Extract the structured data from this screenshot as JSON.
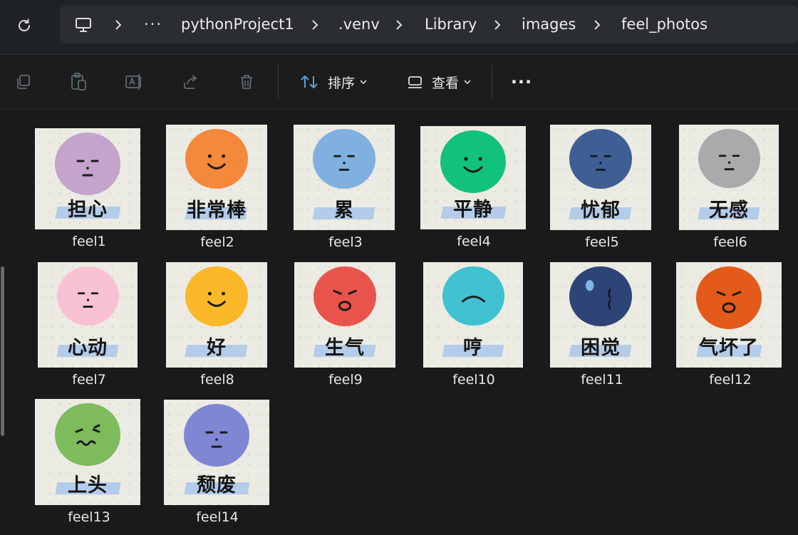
{
  "breadcrumb": {
    "overflow": "···",
    "items": [
      "pythonProject1",
      ".venv",
      "Library",
      "images",
      "feel_photos"
    ]
  },
  "toolbar": {
    "sort_label": "排序",
    "view_label": "查看",
    "more_label": "···"
  },
  "files": [
    {
      "name": "feel1",
      "caption": "担心",
      "color": "#c4a3cc",
      "expr": "worry"
    },
    {
      "name": "feel2",
      "caption": "非常棒",
      "color": "#f5883a",
      "expr": "wink"
    },
    {
      "name": "feel3",
      "caption": "累",
      "color": "#7fb0e0",
      "expr": "tired"
    },
    {
      "name": "feel4",
      "caption": "平静",
      "color": "#12c27a",
      "expr": "calm"
    },
    {
      "name": "feel5",
      "caption": "忧郁",
      "color": "#3f5f94",
      "expr": "sad"
    },
    {
      "name": "feel6",
      "caption": "无感",
      "color": "#a8aaac",
      "expr": "neutral"
    },
    {
      "name": "feel7",
      "caption": "心动",
      "color": "#f9c2d3",
      "expr": "blush"
    },
    {
      "name": "feel8",
      "caption": "好",
      "color": "#fbb829",
      "expr": "smile"
    },
    {
      "name": "feel9",
      "caption": "生气",
      "color": "#e8544c",
      "expr": "angry"
    },
    {
      "name": "feel10",
      "caption": "哼",
      "color": "#3fc1d0",
      "expr": "frown"
    },
    {
      "name": "feel11",
      "caption": "困觉",
      "color": "#2f4476",
      "expr": "sleepy"
    },
    {
      "name": "feel12",
      "caption": "气坏了",
      "color": "#e35a1a",
      "expr": "furious"
    },
    {
      "name": "feel13",
      "caption": "上头",
      "color": "#7dbb5c",
      "expr": "dizzy"
    },
    {
      "name": "feel14",
      "caption": "颓废",
      "color": "#7f86d3",
      "expr": "decadent"
    }
  ]
}
